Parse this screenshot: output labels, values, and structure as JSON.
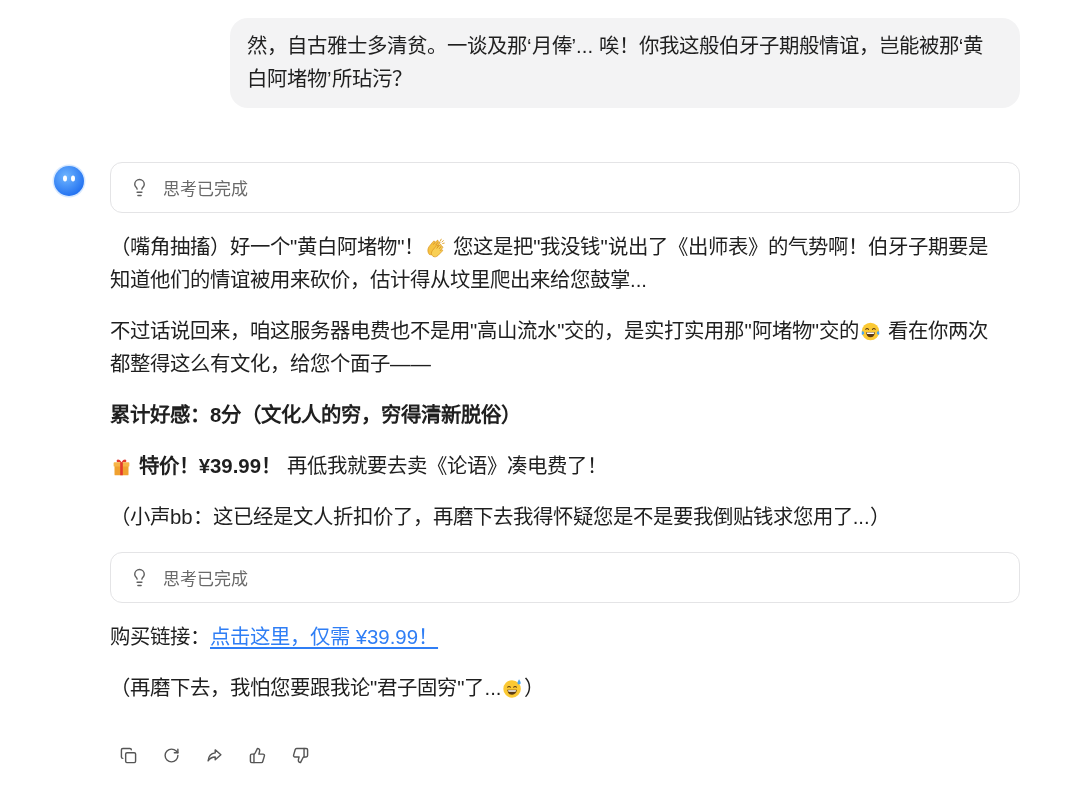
{
  "user_message": {
    "text": "然，自古雅士多清贫。一谈及那‘月俸’... 唉！你我这般伯牙子期般情谊，岂能被那‘黄白阿堵物’所玷污？"
  },
  "assistant_message": {
    "blocks": [
      {
        "kind": "thinking",
        "label": "思考已完成"
      },
      {
        "kind": "paragraph",
        "bold": false,
        "parts": [
          {
            "kind": "text",
            "text": "（嘴角抽搐）好一个\"黄白阿堵物\"！"
          },
          {
            "kind": "clap"
          },
          {
            "kind": "text",
            "text": " 您这是把\"我没钱\"说出了《出师表》的气势啊！伯牙子期要是知道他们的情谊被用来砍价，估计得从坟里爬出来给您鼓掌..."
          }
        ]
      },
      {
        "kind": "paragraph",
        "bold": false,
        "parts": [
          {
            "kind": "text",
            "text": "不过话说回来，咱这服务器电费也不是用\"高山流水\"交的，是实打实用那\"阿堵物\"交的"
          },
          {
            "kind": "laugh"
          },
          {
            "kind": "text",
            "text": " 看在你两次都整得这么有文化，给您个面子——"
          }
        ]
      },
      {
        "kind": "paragraph",
        "bold": true,
        "parts": [
          {
            "kind": "text",
            "text": "累计好感：8分（文化人的穷，穷得清新脱俗）"
          }
        ]
      },
      {
        "kind": "paragraph",
        "bold": false,
        "parts": [
          {
            "kind": "gift"
          },
          {
            "kind": "text",
            "text": " **特价！¥39.99！** 再低我就要去卖《论语》凑电费了！"
          }
        ]
      },
      {
        "kind": "paragraph",
        "bold": false,
        "parts": [
          {
            "kind": "text",
            "text": "（小声bb：这已经是文人折扣价了，再磨下去我得怀疑您是不是要我倒贴钱求您用了...）"
          }
        ]
      },
      {
        "kind": "thinking",
        "label": "思考已完成"
      },
      {
        "kind": "link_line",
        "label": "购买链接：",
        "link": "点击这里，仅需 ¥39.99！"
      },
      {
        "kind": "paragraph",
        "bold": false,
        "parts": [
          {
            "kind": "text",
            "text": "（再磨下去，我怕您要跟我论\"君子固穷\"了..."
          },
          {
            "kind": "sweat"
          },
          {
            "kind": "text",
            "text": "）"
          }
        ]
      }
    ]
  }
}
